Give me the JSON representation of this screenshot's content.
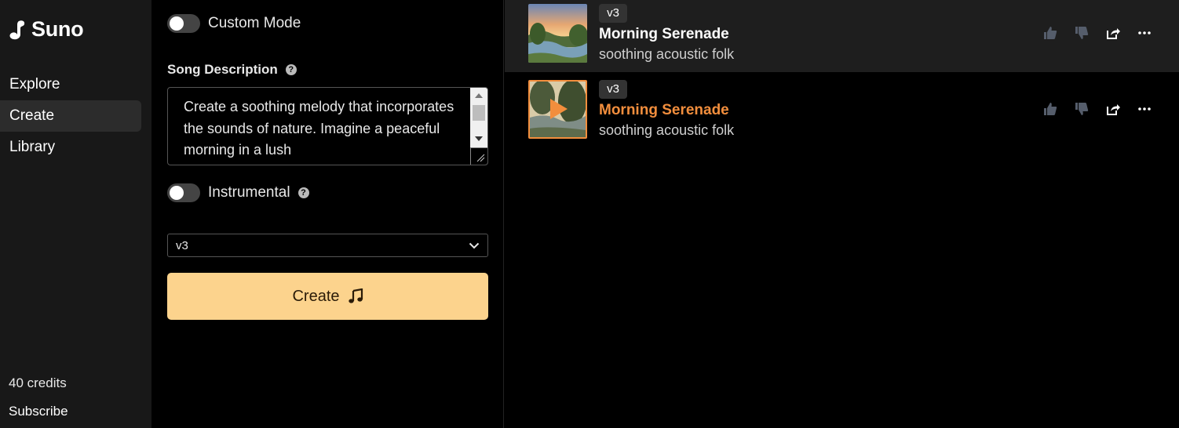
{
  "app": {
    "name": "Suno"
  },
  "sidebar": {
    "items": [
      {
        "label": "Explore"
      },
      {
        "label": "Create"
      },
      {
        "label": "Library"
      }
    ],
    "credits": "40 credits",
    "subscribe": "Subscribe"
  },
  "form": {
    "custom_mode_label": "Custom Mode",
    "description_label": "Song Description",
    "description_value": "Create a soothing melody that incorporates the sounds of nature. Imagine a peaceful morning in a lush",
    "instrumental_label": "Instrumental",
    "model_value": "v3",
    "create_label": "Create"
  },
  "songs": [
    {
      "badge": "v3",
      "title": "Morning Serenade",
      "tags": "soothing acoustic folk"
    },
    {
      "badge": "v3",
      "title": "Morning Serenade",
      "tags": "soothing acoustic folk"
    }
  ],
  "colors": {
    "accent": "#f28e3d",
    "create_button": "#fcd38d"
  }
}
